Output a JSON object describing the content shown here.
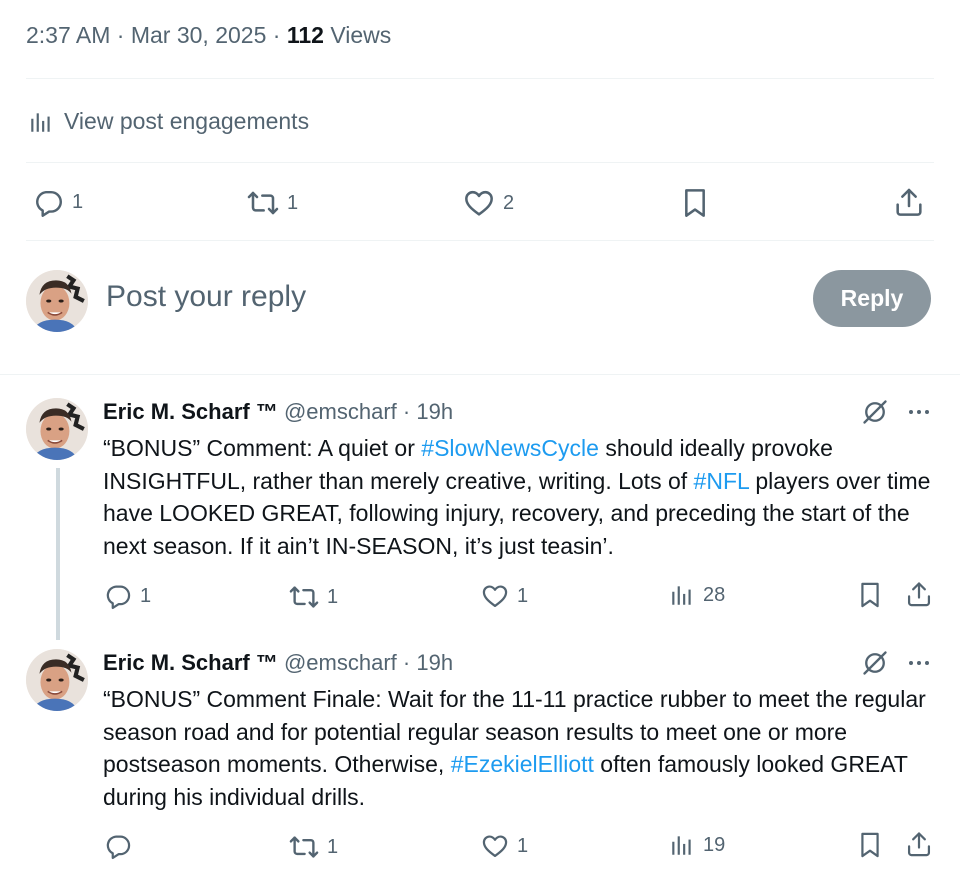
{
  "meta": {
    "time": "2:37 AM",
    "sep1": " · ",
    "date": "Mar 30, 2025",
    "sep2": " · ",
    "views_count": "112",
    "views_label": " Views"
  },
  "engagements_label": "View post engagements",
  "main_actions": {
    "replies": "1",
    "reposts": "1",
    "likes": "2"
  },
  "composer": {
    "placeholder": "Post your reply",
    "reply_button": "Reply"
  },
  "replies": [
    {
      "name": "Eric M. Scharf ™",
      "handle": "@emscharf",
      "time_sep": " · ",
      "time": "19h",
      "text_parts": [
        {
          "t": "“BONUS” Comment: A quiet or "
        },
        {
          "t": "#SlowNewsCycle",
          "tag": true
        },
        {
          "t": " should ideally provoke INSIGHTFUL, rather than merely creative, writing. Lots of "
        },
        {
          "t": "#NFL",
          "tag": true
        },
        {
          "t": " players over time have LOOKED GREAT, following injury, recovery, and preceding the start of the next season. If it ain’t IN-SEASON, it’s just teasin’."
        }
      ],
      "actions": {
        "replies": "1",
        "reposts": "1",
        "likes": "1",
        "views": "28"
      }
    },
    {
      "name": "Eric M. Scharf ™",
      "handle": "@emscharf",
      "time_sep": " · ",
      "time": "19h",
      "text_parts": [
        {
          "t": "“BONUS” Comment Finale: Wait for the 11-11 practice rubber to meet the regular season road and for potential regular season results to meet one or more postseason moments. Otherwise, "
        },
        {
          "t": "#EzekielElliott",
          "tag": true
        },
        {
          "t": " often famously looked GREAT during his individual drills."
        }
      ],
      "actions": {
        "replies": "",
        "reposts": "1",
        "likes": "1",
        "views": "19"
      }
    }
  ],
  "colors": {
    "accent": "#1d9bf0",
    "muted": "#536471",
    "text": "#0f1419",
    "reply_button_bg": "#8b979f",
    "divider": "#eff3f4"
  },
  "icons": [
    "bar-chart-icon",
    "reply-icon",
    "repost-icon",
    "like-icon",
    "bookmark-icon",
    "share-icon",
    "grok-icon",
    "more-icon"
  ]
}
